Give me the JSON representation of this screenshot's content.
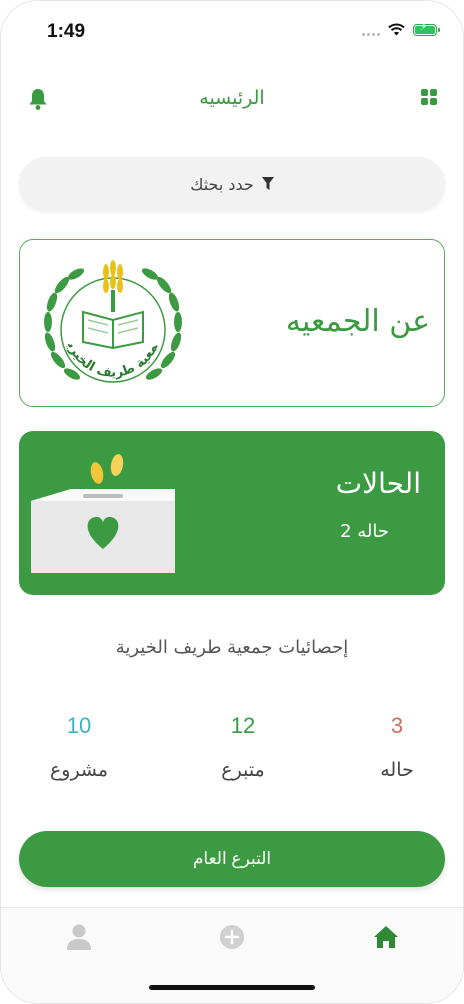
{
  "status_bar": {
    "time": "1:49"
  },
  "header": {
    "title": "الرئيسيه"
  },
  "filter": {
    "label": "حدد بحثك"
  },
  "about": {
    "title": "عن الجمعيه",
    "logo_text": "جمعية طريف الخيرية"
  },
  "cases": {
    "title": "الحالات",
    "count": "2 حاله"
  },
  "stats": {
    "title": "إحصائيات جمعية طريف الخيرية",
    "projects": {
      "value": "10",
      "label": "مشروع",
      "color": "#3cb3c4"
    },
    "donors": {
      "value": "12",
      "label": "متبرع",
      "color": "#3a9a3f"
    },
    "cases": {
      "value": "3",
      "label": "حاله",
      "color": "#c8705a"
    }
  },
  "donate_button": {
    "label": "التبرع العام"
  },
  "tabbar": {
    "items": [
      {
        "icon": "profile-icon"
      },
      {
        "icon": "add-icon"
      },
      {
        "icon": "home-icon",
        "active": true
      }
    ]
  },
  "colors": {
    "primary": "#3c9a42",
    "accent_text": "#3a9a3f"
  }
}
